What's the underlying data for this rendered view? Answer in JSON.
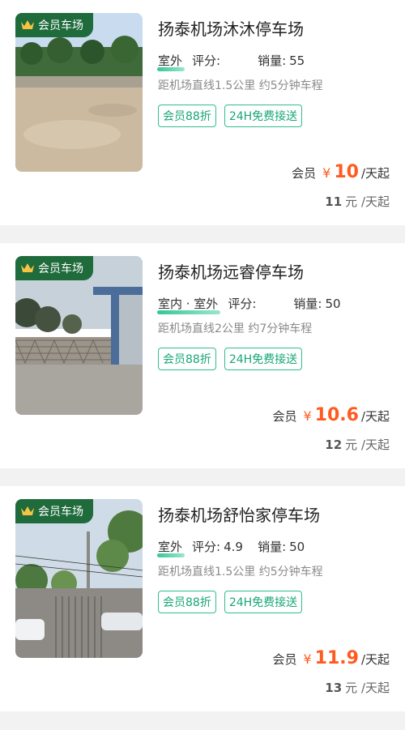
{
  "theme": {
    "accent": "#17a777",
    "price": "#ff5a1f",
    "badge_bg": "#1f6b3c"
  },
  "listings": [
    {
      "badge": "会员车场",
      "name": "扬泰机场沐沐停车场",
      "type": "室外",
      "rating_label": "评分:",
      "rating": "",
      "sales_label": "销量:",
      "sales": "55",
      "distance": "距机场直线1.5公里 约5分钟车程",
      "tags": [
        "会员88折",
        "24H免费接送"
      ],
      "member_label": "会员",
      "currency": "¥",
      "member_price": "10",
      "unit": "/天起",
      "orig_price": "11",
      "orig_unit": "元 /天起",
      "image": "gravel-lot-photo"
    },
    {
      "badge": "会员车场",
      "name": "扬泰机场远睿停车场",
      "type": "室内 · 室外",
      "rating_label": "评分:",
      "rating": "",
      "sales_label": "销量:",
      "sales": "50",
      "distance": "距机场直线2公里 约7分钟车程",
      "tags": [
        "会员88折",
        "24H免费接送"
      ],
      "member_label": "会员",
      "currency": "¥",
      "member_price": "10.6",
      "unit": "/天起",
      "orig_price": "12",
      "orig_unit": "元 /天起",
      "image": "gate-entrance-photo"
    },
    {
      "badge": "会员车场",
      "name": "扬泰机场舒怡家停车场",
      "type": "室外",
      "rating_label": "评分:",
      "rating": "4.9",
      "sales_label": "销量:",
      "sales": "50",
      "distance": "距机场直线1.5公里 约5分钟车程",
      "tags": [
        "会员88折",
        "24H免费接送"
      ],
      "member_label": "会员",
      "currency": "¥",
      "member_price": "11.9",
      "unit": "/天起",
      "orig_price": "13",
      "orig_unit": "元 /天起",
      "image": "fenced-lot-photo"
    }
  ]
}
